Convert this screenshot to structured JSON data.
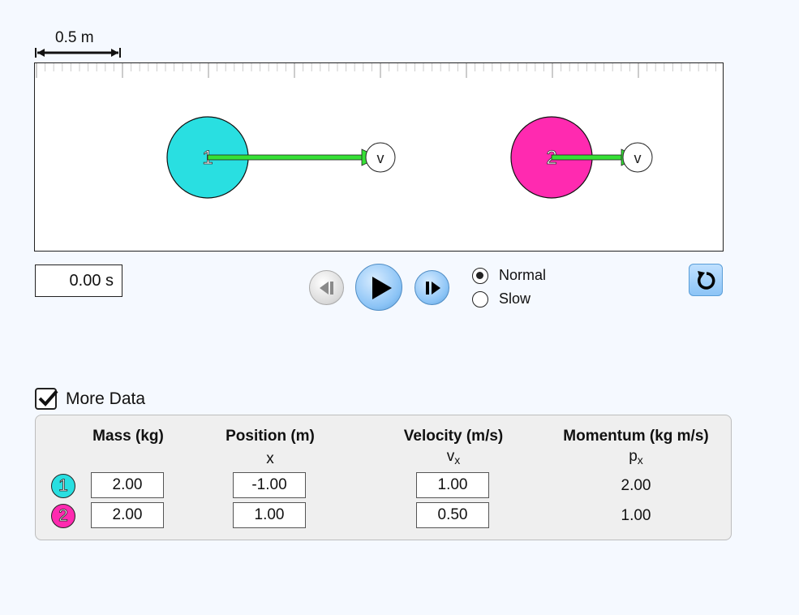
{
  "scale": {
    "label": "0.5 m"
  },
  "playArea": {
    "balls": [
      {
        "label": "1",
        "color": "#29dfe1",
        "velocity_label": "v"
      },
      {
        "label": "2",
        "color": "#ff2ab0",
        "velocity_label": "v"
      }
    ],
    "vector_color": "#35e035"
  },
  "time": {
    "display": "0.00 s"
  },
  "controls": {
    "speed_options": [
      {
        "label": "Normal",
        "checked": true
      },
      {
        "label": "Slow",
        "checked": false
      }
    ],
    "icons": [
      "step-back-icon",
      "play-icon",
      "step-forward-icon",
      "reset-icon"
    ]
  },
  "moreData": {
    "label": "More Data",
    "checked": true
  },
  "table": {
    "headers": {
      "mass": "Mass (kg)",
      "position": "Position (m)",
      "position_symbol": "x",
      "velocity": "Velocity (m/s)",
      "velocity_symbol": "v",
      "velocity_subscript": "x",
      "momentum": "Momentum (kg m/s)",
      "momentum_symbol": "p",
      "momentum_subscript": "x"
    },
    "rows": [
      {
        "ball": "1",
        "color": "#29dfe1",
        "mass": "2.00",
        "position": "-1.00",
        "velocity": "1.00",
        "momentum": "2.00"
      },
      {
        "ball": "2",
        "color": "#ff2ab0",
        "mass": "2.00",
        "position": "1.00",
        "velocity": "0.50",
        "momentum": "1.00"
      }
    ]
  }
}
